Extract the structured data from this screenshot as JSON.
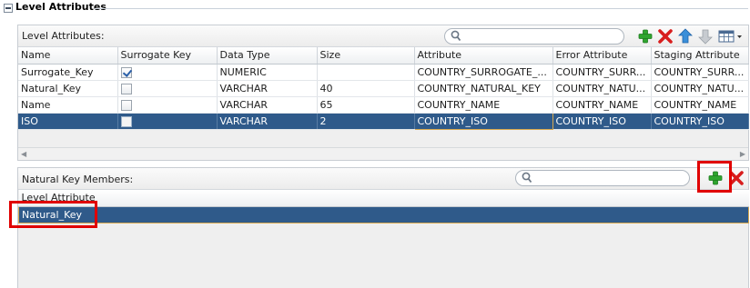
{
  "section": {
    "title": "Level Attributes"
  },
  "top_panel": {
    "label": "Level Attributes:",
    "search": {
      "value": "",
      "placeholder": ""
    },
    "toolbar_icons": [
      "add-icon",
      "delete-icon",
      "move-up-icon",
      "move-down-icon",
      "columns-menu-icon"
    ],
    "columns": [
      "Name",
      "Surrogate Key",
      "Data Type",
      "Size",
      "Attribute",
      "Error Attribute",
      "Staging Attribute"
    ],
    "rows": [
      {
        "name": "Surrogate_Key",
        "surrogate": true,
        "type": "NUMERIC",
        "size": "",
        "attribute": "COUNTRY_SURROGATE_...",
        "error": "COUNTRY_SURR...",
        "staging": "COUNTRY_SURR..."
      },
      {
        "name": "Natural_Key",
        "surrogate": false,
        "type": "VARCHAR",
        "size": "40",
        "attribute": "COUNTRY_NATURAL_KEY",
        "error": "COUNTRY_NATU...",
        "staging": "COUNTRY_NATU..."
      },
      {
        "name": "Name",
        "surrogate": false,
        "type": "VARCHAR",
        "size": "65",
        "attribute": "COUNTRY_NAME",
        "error": "COUNTRY_NAME",
        "staging": "COUNTRY_NAME"
      },
      {
        "name": "ISO",
        "surrogate": false,
        "type": "VARCHAR",
        "size": "2",
        "attribute": "COUNTRY_ISO",
        "error": "COUNTRY_ISO",
        "staging": "COUNTRY_ISO",
        "selected": true
      }
    ]
  },
  "bottom_panel": {
    "label": "Natural Key Members:",
    "search": {
      "value": "",
      "placeholder": ""
    },
    "toolbar_icons": [
      "add-icon",
      "delete-icon"
    ],
    "columns": [
      "Level Attribute"
    ],
    "rows": [
      {
        "name": "Natural_Key",
        "selected": true
      }
    ]
  },
  "colors": {
    "selection": "#2f5a8a",
    "annotation": "#e00000",
    "add_green": "#2fa52f",
    "delete_red": "#d81e1e"
  }
}
